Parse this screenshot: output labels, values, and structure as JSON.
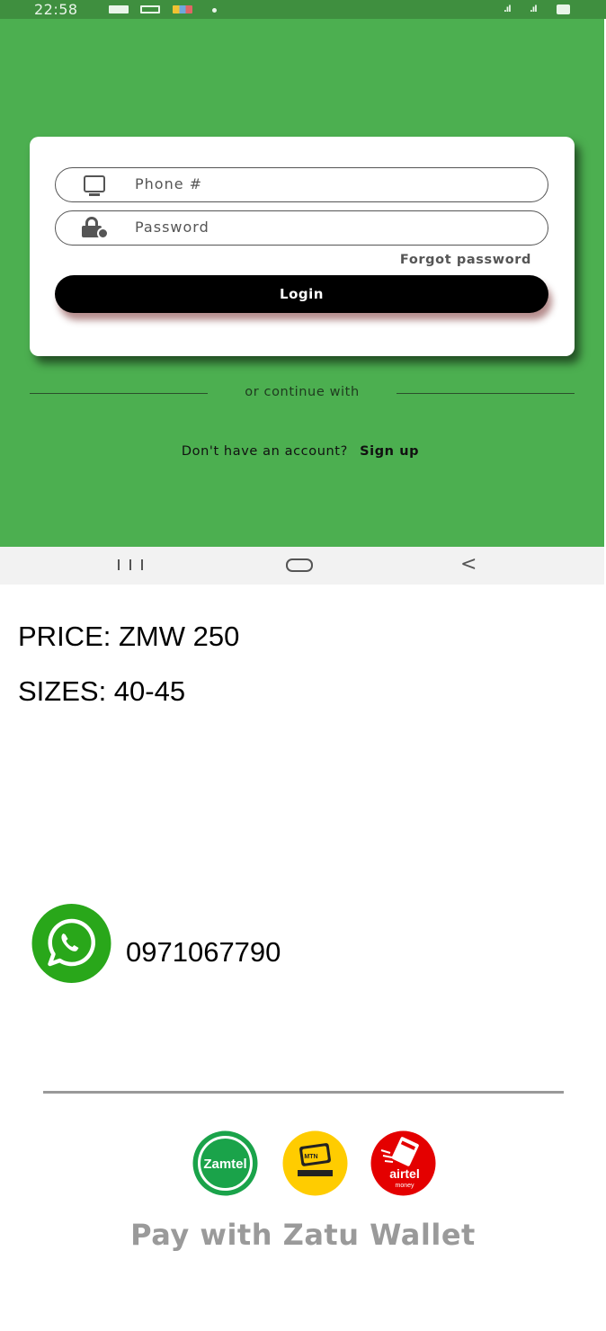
{
  "status_bar": {
    "time": "22:58",
    "signal_1": ".ıl",
    "signal_2": ".ıl"
  },
  "login_screen": {
    "phone_placeholder": "Phone #",
    "password_placeholder": "Password",
    "forgot_password": "Forgot password",
    "login_label": "Login",
    "divider_text": "or continue with",
    "signup_prompt": "Don't have an account?",
    "signup_link": "Sign up",
    "bg_color": "#4caf50"
  },
  "nav_bar": {
    "back_glyph": "<"
  },
  "post": {
    "price": "PRICE: ZMW 250",
    "sizes": "SIZES: 40-45",
    "whatsapp_number": "0971067790"
  },
  "payment": {
    "logos": [
      {
        "name": "Zamtel",
        "label": "Zamtel",
        "color": "#1aa34a"
      },
      {
        "name": "MTN Mobile Money",
        "label": "MTN",
        "color": "#ffcc00"
      },
      {
        "name": "Airtel Money",
        "label": "airtel",
        "sublabel": "money",
        "color": "#e40000"
      }
    ],
    "title": "Pay with Zatu Wallet"
  }
}
